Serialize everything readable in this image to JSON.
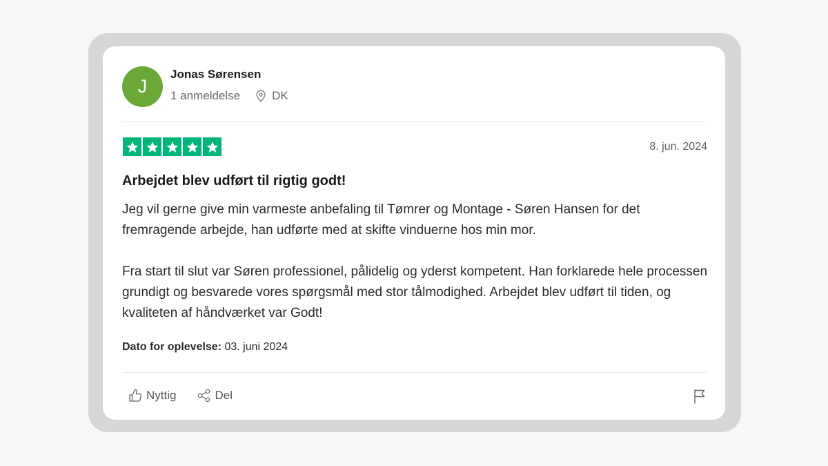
{
  "reviewer": {
    "initial": "J",
    "name": "Jonas Sørensen",
    "reviews_count": "1 anmeldelse",
    "country": "DK"
  },
  "review": {
    "rating": 5,
    "max_rating": 5,
    "date": "8. jun. 2024",
    "title": "Arbejdet blev udført til rigtig godt!",
    "paragraphs": [
      "Jeg vil gerne give min varmeste anbefaling til Tømrer og Montage - Søren Hansen for det fremragende arbejde, han udførte med at skifte vinduerne hos min mor.",
      "Fra start til slut var Søren professionel, pålidelig og yderst kompetent. Han forklarede hele processen grundigt og besvarede vores spørgsmål med stor tålmodighed. Arbejdet blev udført til tiden, og kvaliteten af håndværket var Godt!"
    ],
    "experience_label": "Dato for oplevelse:",
    "experience_date": "03. juni 2024"
  },
  "actions": {
    "useful_label": "Nyttig",
    "share_label": "Del"
  },
  "icons": {
    "location": "map-pin-icon",
    "useful": "thumbs-up-icon",
    "share": "share-icon",
    "report": "flag-icon",
    "star": "star-icon"
  },
  "colors": {
    "avatar": "#6aa937",
    "star": "#00b67a",
    "frame": "#d6d6d8"
  }
}
